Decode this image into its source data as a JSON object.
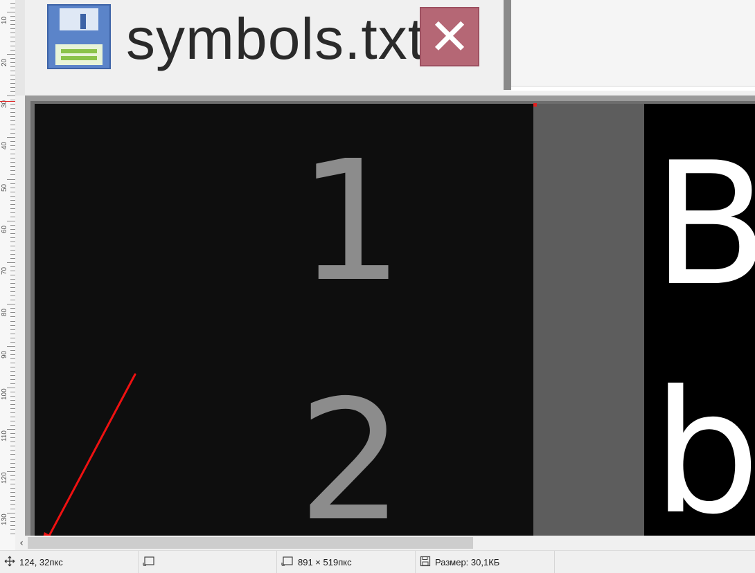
{
  "ruler": {
    "labels": [
      "10",
      "20",
      "30",
      "40",
      "50",
      "60",
      "70",
      "80",
      "90",
      "100",
      "110",
      "120",
      "130"
    ]
  },
  "tab": {
    "title": "symbols.txt",
    "file_icon": "floppy-disk-icon",
    "close_icon": "close-icon",
    "close_color": "#b56775"
  },
  "editor": {
    "line_numbers": [
      "1",
      "2"
    ],
    "text_lines": [
      "B",
      "b"
    ],
    "gutter_color": "#0e0e0e",
    "text_bg_color": "#000000"
  },
  "annotation": {
    "arrow_color": "#ee1111"
  },
  "statusbar": {
    "cursor_position": "124, 32пкс",
    "selection_size": "",
    "image_size": "891 × 519пкс",
    "file_size": "Размер: 30,1КБ"
  }
}
